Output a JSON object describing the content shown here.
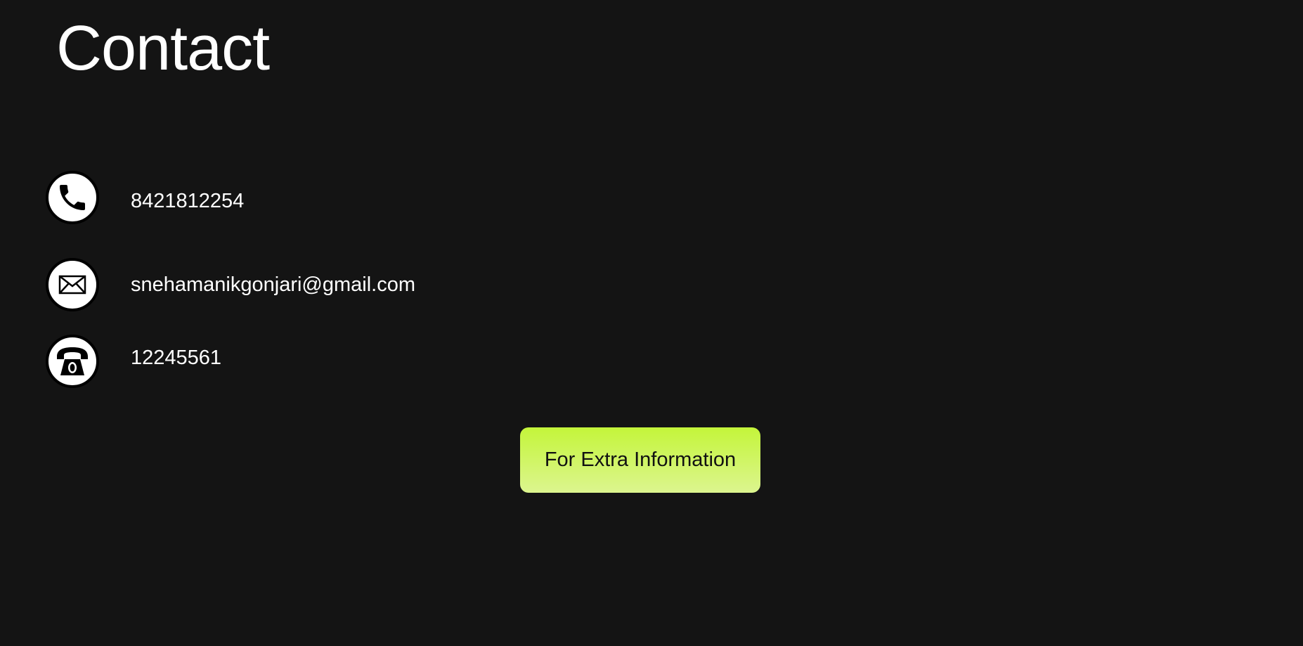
{
  "page": {
    "title": "Contact"
  },
  "contacts": [
    {
      "icon": "phone-icon",
      "value": "8421812254"
    },
    {
      "icon": "mail-icon",
      "value": "snehamanikgonjari@gmail.com"
    },
    {
      "icon": "telephone-icon",
      "value": "12245561"
    }
  ],
  "button": {
    "label": "For Extra Information",
    "gradient_top": "#c4f53a",
    "gradient_bottom": "#dcf58f"
  },
  "colors": {
    "background": "#141414",
    "text": "#ffffff"
  }
}
